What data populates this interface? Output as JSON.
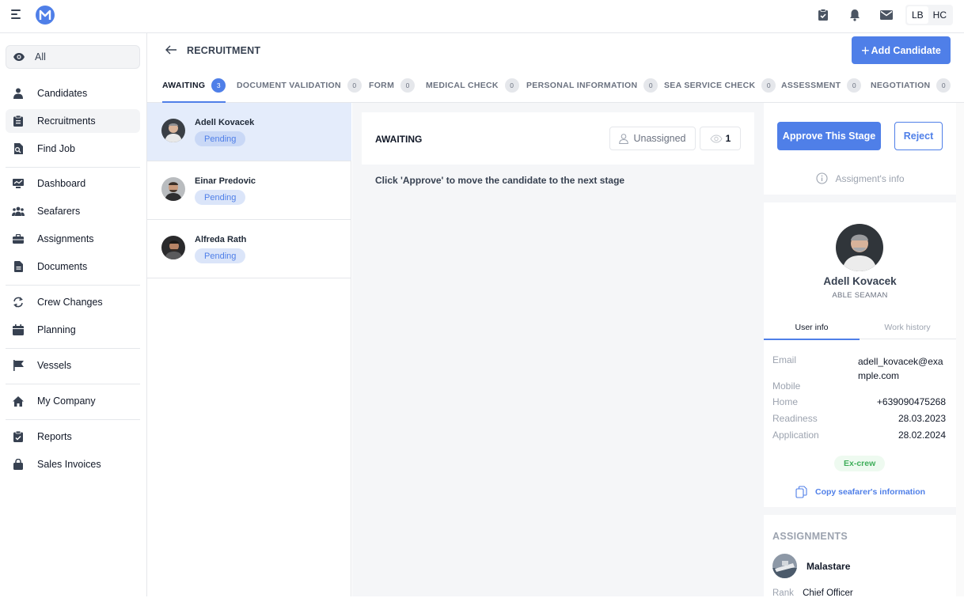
{
  "topbar": {
    "languages": [
      "LB",
      "HC"
    ]
  },
  "sidebar": {
    "filter_label": "All",
    "items": [
      {
        "label": "Candidates",
        "icon": "person-icon"
      },
      {
        "label": "Recruitments",
        "icon": "clipboard-icon",
        "active": true
      },
      {
        "label": "Find Job",
        "icon": "search-doc-icon"
      },
      {
        "label": "Dashboard",
        "icon": "dashboard-icon"
      },
      {
        "label": "Seafarers",
        "icon": "people-icon"
      },
      {
        "label": "Assignments",
        "icon": "briefcase-icon"
      },
      {
        "label": "Documents",
        "icon": "document-icon"
      },
      {
        "label": "Crew Changes",
        "icon": "swap-icon"
      },
      {
        "label": "Planning",
        "icon": "calendar-icon"
      },
      {
        "label": "Vessels",
        "icon": "flag-icon"
      },
      {
        "label": "My Company",
        "icon": "home-icon"
      },
      {
        "label": "Reports",
        "icon": "report-icon"
      },
      {
        "label": "Sales Invoices",
        "icon": "lock-bag-icon"
      }
    ]
  },
  "header": {
    "title": "RECRUITMENT",
    "add_label": "Add Candidate"
  },
  "tabs": [
    {
      "label": "AWAITING",
      "count": "3"
    },
    {
      "label": "DOCUMENT VALIDATION",
      "count": "0"
    },
    {
      "label": "FORM",
      "count": "0"
    },
    {
      "label": "MEDICAL CHECK",
      "count": "0"
    },
    {
      "label": "PERSONAL INFORMATION",
      "count": "0"
    },
    {
      "label": "SEA SERVICE CHECK",
      "count": "0"
    },
    {
      "label": "ASSESSMENT",
      "count": "0"
    },
    {
      "label": "NEGOTIATION",
      "count": "0"
    }
  ],
  "candidates": [
    {
      "name": "Adell Kovacek",
      "status": "Pending"
    },
    {
      "name": "Einar Predovic",
      "status": "Pending"
    },
    {
      "name": "Alfreda Rath",
      "status": "Pending"
    }
  ],
  "stage": {
    "title": "AWAITING",
    "assignee": "Unassigned",
    "watchers": "1",
    "hint": "Click 'Approve' to move the candidate to the next stage"
  },
  "panel": {
    "approve_label": "Approve This Stage",
    "reject_label": "Reject",
    "assign_info": "Assigment's info",
    "name": "Adell Kovacek",
    "rank": "ABLE SEAMAN",
    "sub_tabs": [
      "User info",
      "Work history"
    ],
    "info": {
      "email_label": "Email",
      "email": "adell_kovacek@example.com",
      "mobile_label": "Mobile",
      "home_label": "Home",
      "home": "+639090475268",
      "readiness_label": "Readiness",
      "readiness": "28.03.2023",
      "application_label": "Application",
      "application": "28.02.2024"
    },
    "tag": "Ex-crew",
    "copy_label": "Copy seafarer's information",
    "assignments_title": "ASSIGNMENTS",
    "vessel": "Malastare",
    "rank_label": "Rank",
    "rank_value": "Chief Officer"
  },
  "colors": {
    "accent": "#4f7fe8",
    "active_row": "#e4ecfb",
    "success": "#3fae5a"
  }
}
